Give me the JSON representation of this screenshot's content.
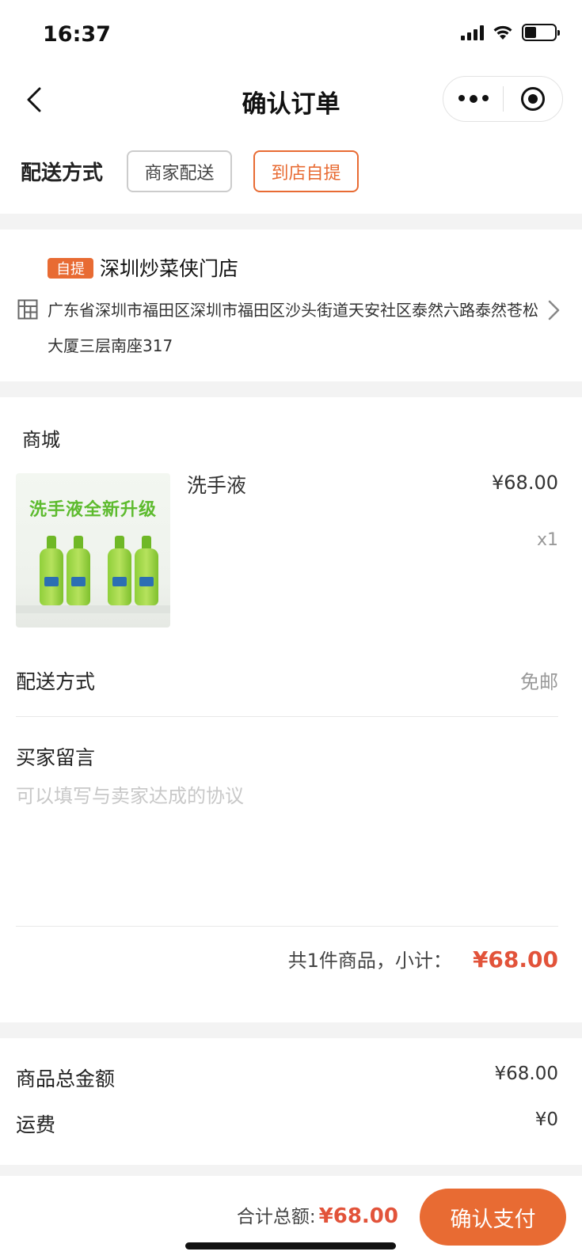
{
  "status_bar": {
    "time": "16:37"
  },
  "nav": {
    "title": "确认订单"
  },
  "delivery": {
    "label": "配送方式",
    "options": [
      {
        "label": "商家配送",
        "selected": false
      },
      {
        "label": "到店自提",
        "selected": true
      }
    ]
  },
  "store": {
    "badge": "自提",
    "name": "深圳炒菜侠门店",
    "address": "广东省深圳市福田区深圳市福田区沙头街道天安社区泰然六路泰然苍松大厦三层南座317"
  },
  "order": {
    "shop_label": "商城",
    "product": {
      "name": "洗手液",
      "price": "¥68.00",
      "quantity": "x1",
      "image_promo_text": "洗手液全新升级"
    },
    "shipping": {
      "label": "配送方式",
      "value": "免邮"
    },
    "buyer_note": {
      "label": "买家留言",
      "placeholder": "可以填写与卖家达成的协议",
      "value": ""
    },
    "subtotal": {
      "text": "共1件商品，小计：",
      "amount": "¥68.00"
    }
  },
  "totals": {
    "goods_total": {
      "label": "商品总金额",
      "value": "¥68.00"
    },
    "freight": {
      "label": "运费",
      "value": "¥0"
    }
  },
  "footer": {
    "total_label": "合计总额:",
    "total_amount": "¥68.00",
    "pay_label": "确认支付"
  },
  "colors": {
    "accent": "#e86b33",
    "price_red": "#e2533a",
    "background": "#f3f3f3"
  }
}
